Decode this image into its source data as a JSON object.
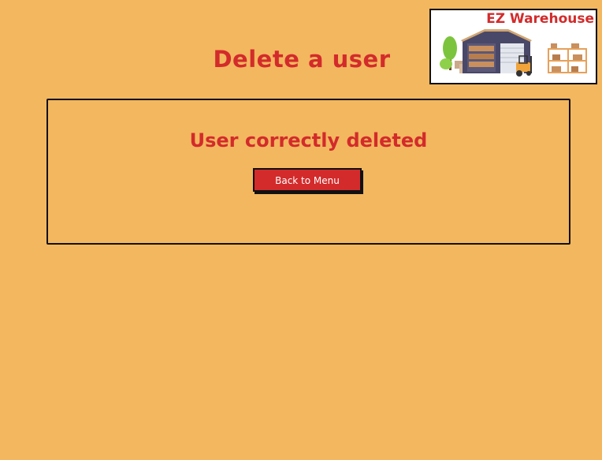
{
  "page": {
    "title": "Delete a user",
    "background_color": "#f3b75f",
    "accent_color": "#d32b2b"
  },
  "logo": {
    "text": "EZ Warehouse",
    "icon": "warehouse-illustration-icon"
  },
  "result_panel": {
    "message": "User correctly deleted",
    "back_button_label": "Back to Menu"
  }
}
